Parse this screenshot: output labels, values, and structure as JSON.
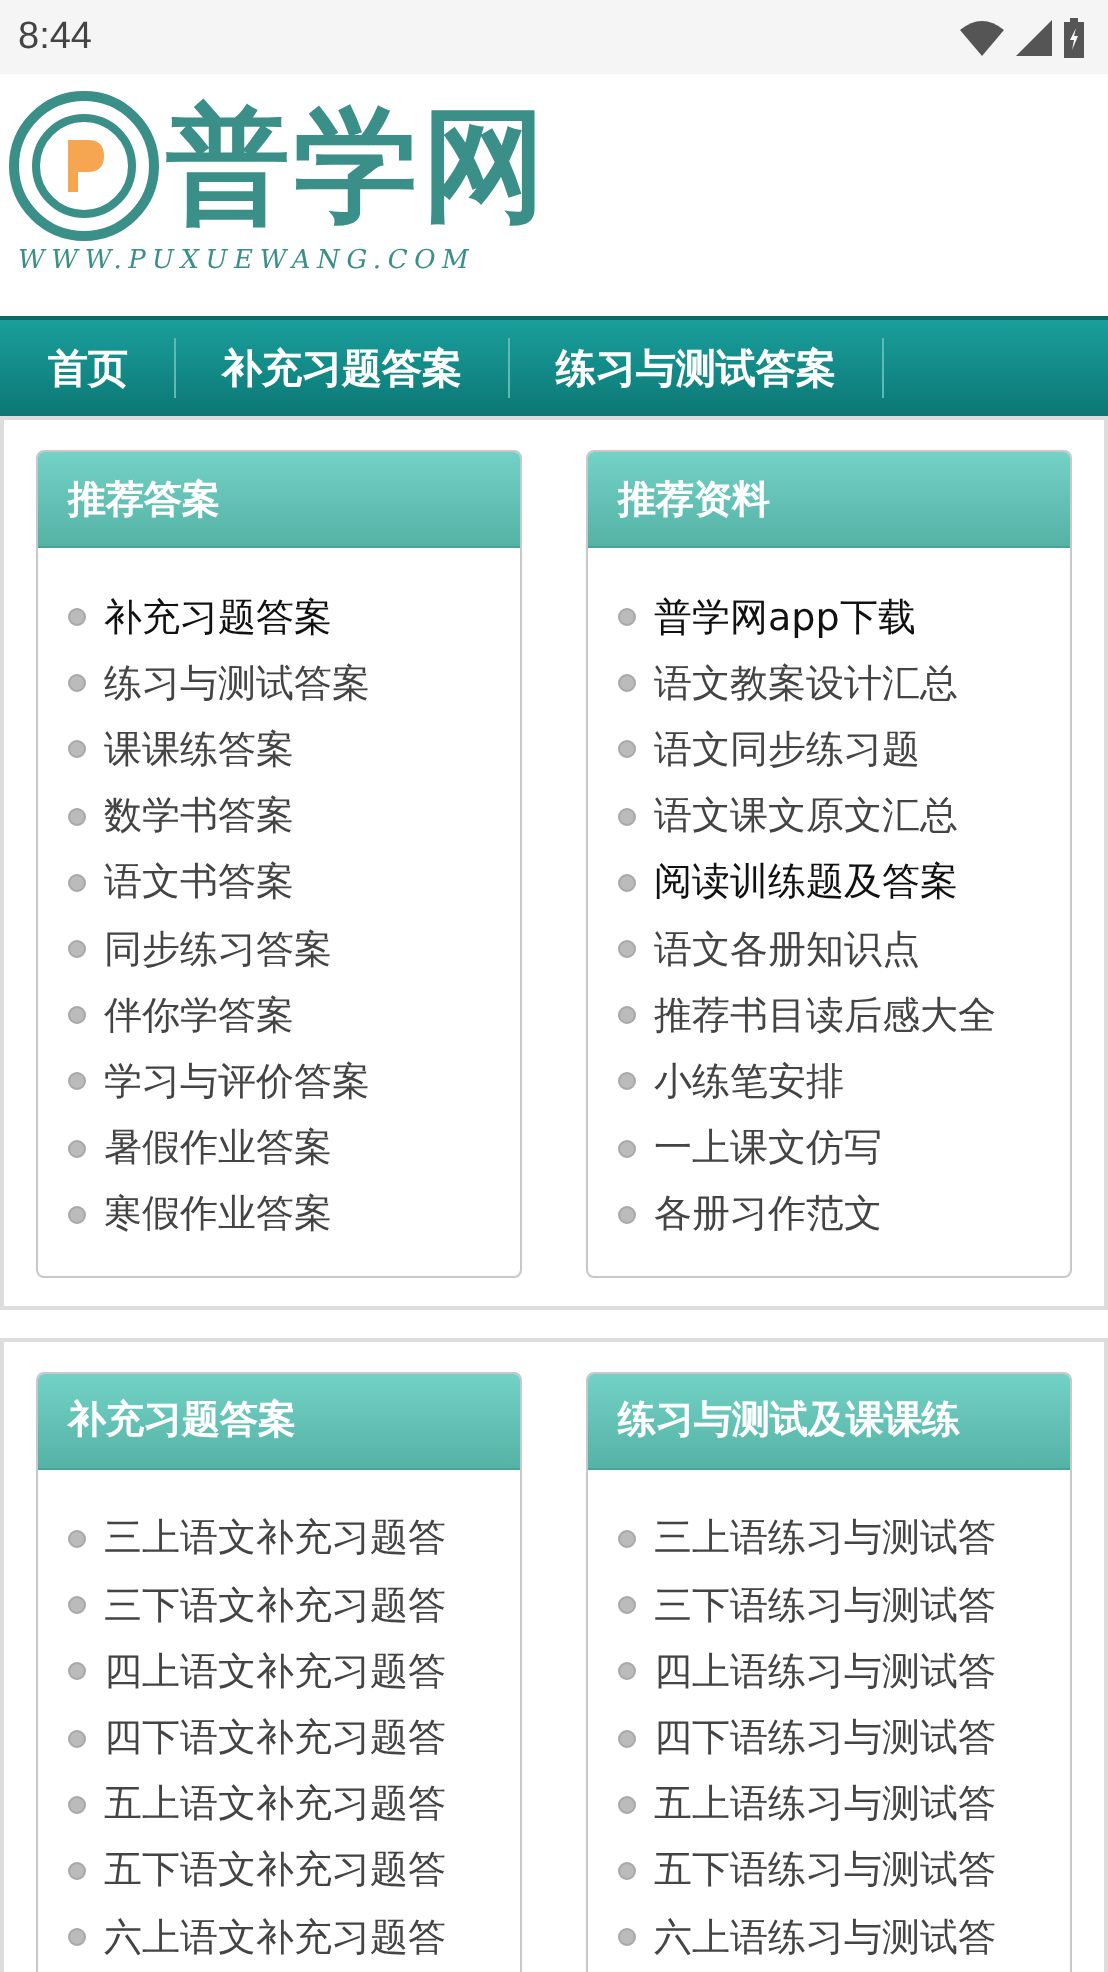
{
  "status_bar": {
    "time": "8:44"
  },
  "logo": {
    "title": "普学网",
    "url": "WWW.PUXUEWANG.COM"
  },
  "nav": {
    "items": [
      {
        "label": "首页"
      },
      {
        "label": "补充习题答案"
      },
      {
        "label": "练习与测试答案"
      }
    ]
  },
  "sections": [
    {
      "panels": [
        {
          "title": "推荐答案",
          "items": [
            {
              "label": "补充习题答案",
              "visited": false
            },
            {
              "label": "练习与测试答案",
              "visited": true
            },
            {
              "label": "课课练答案",
              "visited": true
            },
            {
              "label": "数学书答案",
              "visited": true
            },
            {
              "label": "语文书答案",
              "visited": true
            },
            {
              "label": "同步练习答案",
              "visited": true
            },
            {
              "label": "伴你学答案",
              "visited": true
            },
            {
              "label": "学习与评价答案",
              "visited": true
            },
            {
              "label": "暑假作业答案",
              "visited": true
            },
            {
              "label": "寒假作业答案",
              "visited": true
            }
          ]
        },
        {
          "title": "推荐资料",
          "items": [
            {
              "label": "普学网app下载",
              "visited": false
            },
            {
              "label": "语文教案设计汇总",
              "visited": true
            },
            {
              "label": "语文同步练习题",
              "visited": true
            },
            {
              "label": "语文课文原文汇总",
              "visited": true
            },
            {
              "label": "阅读训练题及答案",
              "visited": false
            },
            {
              "label": "语文各册知识点",
              "visited": true
            },
            {
              "label": "推荐书目读后感大全",
              "visited": true
            },
            {
              "label": "小练笔安排",
              "visited": true
            },
            {
              "label": "一上课文仿写",
              "visited": true
            },
            {
              "label": "各册习作范文",
              "visited": true
            }
          ]
        }
      ]
    },
    {
      "panels": [
        {
          "title": "补充习题答案",
          "items": [
            {
              "label": "三上语文补充习题答",
              "visited": true
            },
            {
              "label": "三下语文补充习题答",
              "visited": true
            },
            {
              "label": "四上语文补充习题答",
              "visited": true
            },
            {
              "label": "四下语文补充习题答",
              "visited": true
            },
            {
              "label": "五上语文补充习题答",
              "visited": true
            },
            {
              "label": "五下语文补充习题答",
              "visited": true
            },
            {
              "label": "六上语文补充习题答",
              "visited": true
            }
          ]
        },
        {
          "title": "练习与测试及课课练",
          "items": [
            {
              "label": "三上语练习与测试答",
              "visited": true
            },
            {
              "label": "三下语练习与测试答",
              "visited": true
            },
            {
              "label": "四上语练习与测试答",
              "visited": true
            },
            {
              "label": "四下语练习与测试答",
              "visited": true
            },
            {
              "label": "五上语练习与测试答",
              "visited": true
            },
            {
              "label": "五下语练习与测试答",
              "visited": true
            },
            {
              "label": "六上语练习与测试答",
              "visited": true
            }
          ]
        }
      ]
    }
  ]
}
